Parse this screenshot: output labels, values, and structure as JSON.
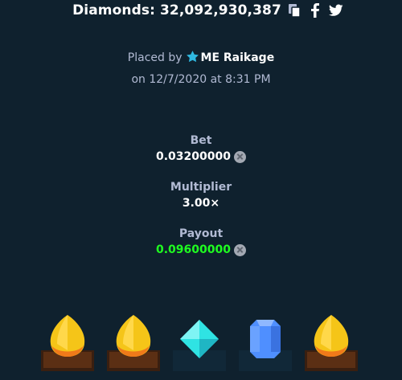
{
  "header": {
    "title": "Diamonds: 32,092,930,387",
    "icons": [
      "copy-icon",
      "facebook-icon",
      "twitter-icon"
    ]
  },
  "placed": {
    "prefix": "Placed by",
    "username": "ME Raikage",
    "date_line": "on 12/7/2020 at 8:31 PM"
  },
  "bet": {
    "label": "Bet",
    "value": "0.03200000",
    "currency_icon": "currency-coin-icon"
  },
  "multiplier": {
    "label": "Multiplier",
    "value": "3.00×"
  },
  "payout": {
    "label": "Payout",
    "value": "0.09600000",
    "currency_icon": "currency-coin-icon",
    "value_color": "#1fff20"
  },
  "result_gems": [
    {
      "name": "yellow-gem-icon",
      "color": "#f5c518",
      "on_pedestal": true
    },
    {
      "name": "yellow-gem-icon",
      "color": "#f5c518",
      "on_pedestal": true
    },
    {
      "name": "cyan-gem-icon",
      "color": "#2fe3e3",
      "on_pedestal": false
    },
    {
      "name": "blue-gem-icon",
      "color": "#4f8fff",
      "on_pedestal": false
    },
    {
      "name": "yellow-gem-icon",
      "color": "#f5c518",
      "on_pedestal": true
    }
  ],
  "colors": {
    "background": "#0f212e",
    "label": "#b1bad3",
    "star": "#2fb8e0"
  }
}
